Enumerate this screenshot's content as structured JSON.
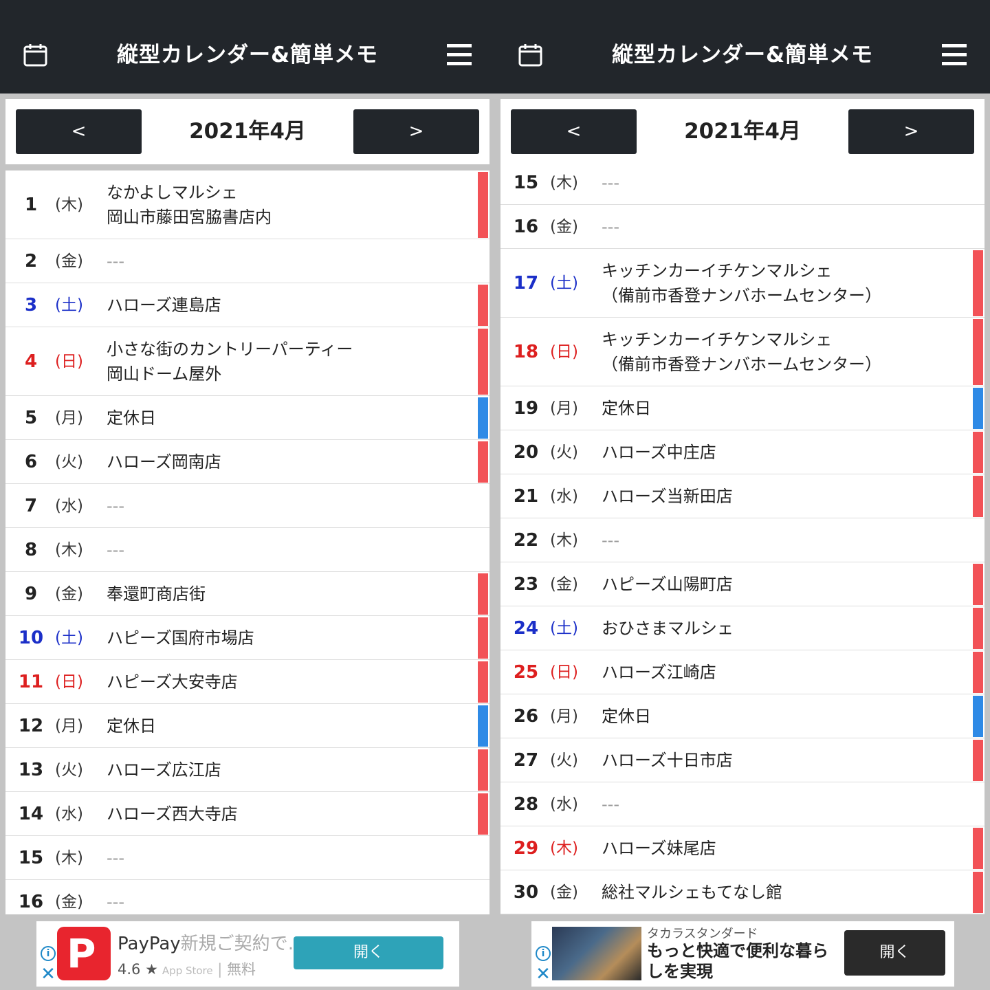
{
  "panes": [
    {
      "app_title": "縦型カレンダー&簡単メモ",
      "prev_label": "<",
      "next_label": ">",
      "month_label": "2021年4月",
      "rows": [
        {
          "day": "1",
          "wd": "(木)",
          "memo": [
            "なかよしマルシェ",
            "岡山市藤田宮脇書店内"
          ],
          "type": "normal",
          "bar": "red"
        },
        {
          "day": "2",
          "wd": "(金)",
          "memo": [
            "---"
          ],
          "type": "normal",
          "bar": ""
        },
        {
          "day": "3",
          "wd": "(土)",
          "memo": [
            "ハローズ連島店"
          ],
          "type": "sat",
          "bar": "red"
        },
        {
          "day": "4",
          "wd": "(日)",
          "memo": [
            "小さな街のカントリーパーティー",
            "岡山ドーム屋外"
          ],
          "type": "sun",
          "bar": "red"
        },
        {
          "day": "5",
          "wd": "(月)",
          "memo": [
            "定休日"
          ],
          "type": "normal",
          "bar": "blue"
        },
        {
          "day": "6",
          "wd": "(火)",
          "memo": [
            "ハローズ岡南店"
          ],
          "type": "normal",
          "bar": "red"
        },
        {
          "day": "7",
          "wd": "(水)",
          "memo": [
            "---"
          ],
          "type": "normal",
          "bar": ""
        },
        {
          "day": "8",
          "wd": "(木)",
          "memo": [
            "---"
          ],
          "type": "normal",
          "bar": ""
        },
        {
          "day": "9",
          "wd": "(金)",
          "memo": [
            "奉還町商店街"
          ],
          "type": "normal",
          "bar": "red"
        },
        {
          "day": "10",
          "wd": "(土)",
          "memo": [
            "ハピーズ国府市場店"
          ],
          "type": "sat",
          "bar": "red"
        },
        {
          "day": "11",
          "wd": "(日)",
          "memo": [
            "ハピーズ大安寺店"
          ],
          "type": "sun",
          "bar": "red"
        },
        {
          "day": "12",
          "wd": "(月)",
          "memo": [
            "定休日"
          ],
          "type": "normal",
          "bar": "blue"
        },
        {
          "day": "13",
          "wd": "(火)",
          "memo": [
            "ハローズ広江店"
          ],
          "type": "normal",
          "bar": "red"
        },
        {
          "day": "14",
          "wd": "(水)",
          "memo": [
            "ハローズ西大寺店"
          ],
          "type": "normal",
          "bar": "red"
        },
        {
          "day": "15",
          "wd": "(木)",
          "memo": [
            "---"
          ],
          "type": "normal",
          "bar": ""
        },
        {
          "day": "16",
          "wd": "(金)",
          "memo": [
            "---"
          ],
          "type": "normal",
          "bar": ""
        }
      ],
      "ad": {
        "kind": "app",
        "name": "PayPay",
        "name_suffix": "新規ご契約で…",
        "rating": "4.6 ★",
        "store": "App Store",
        "price": "無料",
        "logo_letter": "P",
        "open_label": "開く",
        "info_icon": "i",
        "close_icon": "✕"
      }
    },
    {
      "app_title": "縦型カレンダー&簡単メモ",
      "prev_label": "<",
      "next_label": ">",
      "month_label": "2021年4月",
      "rows": [
        {
          "day": "15",
          "wd": "(木)",
          "memo": [
            "---"
          ],
          "type": "normal",
          "bar": ""
        },
        {
          "day": "16",
          "wd": "(金)",
          "memo": [
            "---"
          ],
          "type": "normal",
          "bar": ""
        },
        {
          "day": "17",
          "wd": "(土)",
          "memo": [
            "キッチンカーイチケンマルシェ",
            "（備前市香登ナンバホームセンター）"
          ],
          "type": "sat",
          "bar": "red"
        },
        {
          "day": "18",
          "wd": "(日)",
          "memo": [
            "キッチンカーイチケンマルシェ",
            "（備前市香登ナンバホームセンター）"
          ],
          "type": "sun",
          "bar": "red"
        },
        {
          "day": "19",
          "wd": "(月)",
          "memo": [
            "定休日"
          ],
          "type": "normal",
          "bar": "blue"
        },
        {
          "day": "20",
          "wd": "(火)",
          "memo": [
            "ハローズ中庄店"
          ],
          "type": "normal",
          "bar": "red"
        },
        {
          "day": "21",
          "wd": "(水)",
          "memo": [
            "ハローズ当新田店"
          ],
          "type": "normal",
          "bar": "red"
        },
        {
          "day": "22",
          "wd": "(木)",
          "memo": [
            "---"
          ],
          "type": "normal",
          "bar": ""
        },
        {
          "day": "23",
          "wd": "(金)",
          "memo": [
            "ハピーズ山陽町店"
          ],
          "type": "normal",
          "bar": "red"
        },
        {
          "day": "24",
          "wd": "(土)",
          "memo": [
            "おひさまマルシェ"
          ],
          "type": "sat",
          "bar": "red"
        },
        {
          "day": "25",
          "wd": "(日)",
          "memo": [
            "ハローズ江崎店"
          ],
          "type": "sun",
          "bar": "red"
        },
        {
          "day": "26",
          "wd": "(月)",
          "memo": [
            "定休日"
          ],
          "type": "normal",
          "bar": "blue"
        },
        {
          "day": "27",
          "wd": "(火)",
          "memo": [
            "ハローズ十日市店"
          ],
          "type": "normal",
          "bar": "red"
        },
        {
          "day": "28",
          "wd": "(水)",
          "memo": [
            "---"
          ],
          "type": "normal",
          "bar": ""
        },
        {
          "day": "29",
          "wd": "(木)",
          "memo": [
            "ハローズ妹尾店"
          ],
          "type": "sun",
          "bar": "red"
        },
        {
          "day": "30",
          "wd": "(金)",
          "memo": [
            "総社マルシェもてなし館"
          ],
          "type": "normal",
          "bar": "red"
        }
      ],
      "ad": {
        "kind": "banner",
        "brand": "タカラスタンダード",
        "headline": "もっと快適で便利な暮らしを実現",
        "open_label": "開く",
        "info_icon": "i",
        "close_icon": "✕"
      }
    }
  ],
  "colors": {
    "header_bg": "#22262b",
    "bar_red": "#f25257",
    "bar_blue": "#2e8ae6",
    "saturday": "#1b2fc8",
    "sunday": "#dd1f1f"
  },
  "icons": {
    "calendar": "calendar-icon",
    "menu": "hamburger-menu-icon"
  }
}
